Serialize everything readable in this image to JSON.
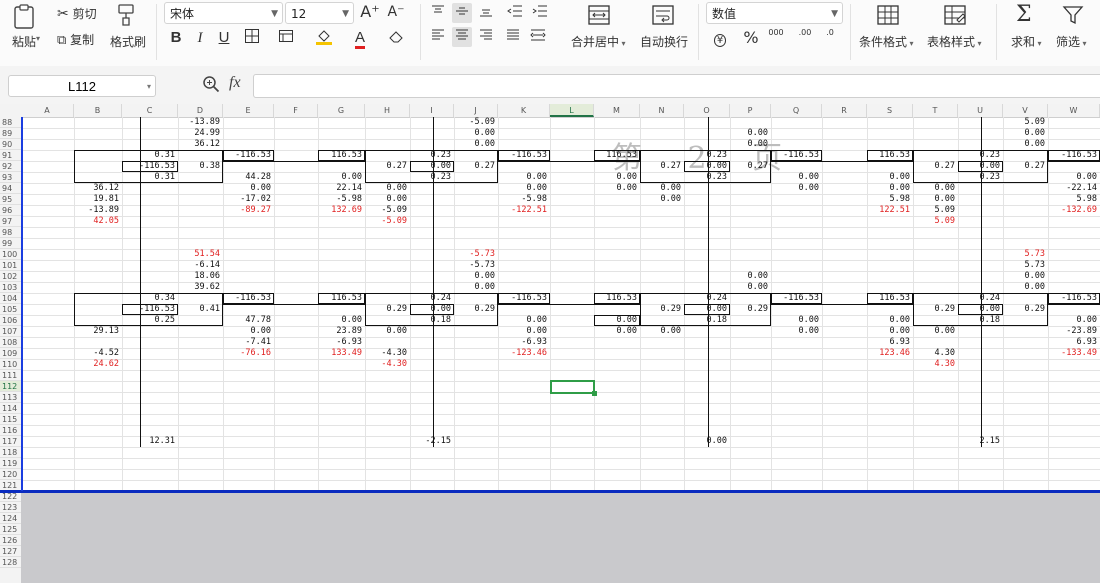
{
  "ribbon": {
    "paste_label": "粘贴",
    "cut_label": "剪切",
    "copy_label": "复制",
    "format_painter_label": "格式刷",
    "font_name": "宋体",
    "font_size": "12",
    "merge_center_label": "合并居中",
    "wrap_text_label": "自动换行",
    "number_format": "数值",
    "conditional_format_label": "条件格式",
    "table_style_label": "表格样式",
    "sum_label": "求和",
    "filter_label": "筛选",
    "grow_font": "A⁺",
    "shrink_font": "A⁻",
    "bold": "B",
    "italic": "I",
    "underline": "U",
    "percent": "%",
    "thousands": "000",
    "inc_decimal": ".00",
    "dec_decimal": ".0",
    "currency": "¥"
  },
  "formula_bar": {
    "name_box": "L112",
    "fx": "fx",
    "formula": ""
  },
  "watermark": "第 2 页",
  "columns": [
    "A",
    "B",
    "C",
    "D",
    "E",
    "F",
    "G",
    "H",
    "I",
    "J",
    "K",
    "L",
    "M",
    "N",
    "O",
    "P",
    "Q",
    "R",
    "S",
    "T",
    "U",
    "V",
    "W"
  ],
  "active_column": "L",
  "rows": [
    "88",
    "89",
    "90",
    "91",
    "92",
    "93",
    "94",
    "95",
    "96",
    "97",
    "98",
    "99",
    "100",
    "101",
    "102",
    "103",
    "104",
    "105",
    "106",
    "107",
    "108",
    "109",
    "110",
    "111",
    "112",
    "113",
    "114",
    "115",
    "116",
    "117",
    "118",
    "119",
    "120",
    "121",
    "122",
    "123",
    "124",
    "125",
    "126",
    "127",
    "128"
  ],
  "active_row": "112",
  "cells": [
    {
      "r": "88",
      "c": "D",
      "v": "-13.89"
    },
    {
      "r": "89",
      "c": "D",
      "v": "24.99"
    },
    {
      "r": "90",
      "c": "D",
      "v": "36.12"
    },
    {
      "r": "88",
      "c": "J",
      "v": "-5.09"
    },
    {
      "r": "89",
      "c": "J",
      "v": "0.00"
    },
    {
      "r": "90",
      "c": "J",
      "v": "0.00"
    },
    {
      "r": "89",
      "c": "P",
      "v": "0.00"
    },
    {
      "r": "90",
      "c": "P",
      "v": "0.00"
    },
    {
      "r": "88",
      "c": "V",
      "v": "5.09"
    },
    {
      "r": "89",
      "c": "V",
      "v": "0.00"
    },
    {
      "r": "90",
      "c": "V",
      "v": "0.00"
    },
    {
      "r": "91",
      "c": "C",
      "v": "0.31"
    },
    {
      "r": "91",
      "c": "E",
      "v": "-116.53"
    },
    {
      "r": "91",
      "c": "G",
      "v": "116.53"
    },
    {
      "r": "91",
      "c": "I",
      "v": "0.23"
    },
    {
      "r": "91",
      "c": "K",
      "v": "-116.53"
    },
    {
      "r": "91",
      "c": "M",
      "v": "116.53"
    },
    {
      "r": "91",
      "c": "O",
      "v": "0.23"
    },
    {
      "r": "91",
      "c": "Q",
      "v": "-116.53"
    },
    {
      "r": "91",
      "c": "S",
      "v": "116.53"
    },
    {
      "r": "91",
      "c": "U",
      "v": "0.23"
    },
    {
      "r": "91",
      "c": "W",
      "v": "-116.53"
    },
    {
      "r": "92",
      "c": "C",
      "v": "-116.53"
    },
    {
      "r": "92",
      "c": "D",
      "v": "0.38"
    },
    {
      "r": "92",
      "c": "H",
      "v": "0.27"
    },
    {
      "r": "92",
      "c": "I",
      "v": "0.00"
    },
    {
      "r": "92",
      "c": "J",
      "v": "0.27"
    },
    {
      "r": "92",
      "c": "N",
      "v": "0.27"
    },
    {
      "r": "92",
      "c": "O",
      "v": "0.00"
    },
    {
      "r": "92",
      "c": "P",
      "v": "0.27"
    },
    {
      "r": "92",
      "c": "T",
      "v": "0.27"
    },
    {
      "r": "92",
      "c": "U",
      "v": "0.00"
    },
    {
      "r": "92",
      "c": "V",
      "v": "0.27"
    },
    {
      "r": "93",
      "c": "C",
      "v": "0.31"
    },
    {
      "r": "93",
      "c": "E",
      "v": "44.28"
    },
    {
      "r": "93",
      "c": "G",
      "v": "0.00"
    },
    {
      "r": "93",
      "c": "I",
      "v": "0.23"
    },
    {
      "r": "93",
      "c": "K",
      "v": "0.00"
    },
    {
      "r": "93",
      "c": "M",
      "v": "0.00"
    },
    {
      "r": "93",
      "c": "O",
      "v": "0.23"
    },
    {
      "r": "93",
      "c": "Q",
      "v": "0.00"
    },
    {
      "r": "93",
      "c": "S",
      "v": "0.00"
    },
    {
      "r": "93",
      "c": "U",
      "v": "0.23"
    },
    {
      "r": "93",
      "c": "W",
      "v": "0.00"
    },
    {
      "r": "94",
      "c": "B",
      "v": "36.12"
    },
    {
      "r": "94",
      "c": "E",
      "v": "0.00"
    },
    {
      "r": "94",
      "c": "G",
      "v": "22.14"
    },
    {
      "r": "94",
      "c": "H",
      "v": "0.00"
    },
    {
      "r": "94",
      "c": "K",
      "v": "0.00"
    },
    {
      "r": "94",
      "c": "M",
      "v": "0.00"
    },
    {
      "r": "94",
      "c": "N",
      "v": "0.00"
    },
    {
      "r": "94",
      "c": "Q",
      "v": "0.00"
    },
    {
      "r": "94",
      "c": "S",
      "v": "0.00"
    },
    {
      "r": "94",
      "c": "T",
      "v": "0.00"
    },
    {
      "r": "94",
      "c": "W",
      "v": "-22.14"
    },
    {
      "r": "95",
      "c": "B",
      "v": "19.81"
    },
    {
      "r": "95",
      "c": "E",
      "v": "-17.02"
    },
    {
      "r": "95",
      "c": "G",
      "v": "-5.98"
    },
    {
      "r": "95",
      "c": "H",
      "v": "0.00"
    },
    {
      "r": "95",
      "c": "K",
      "v": "-5.98"
    },
    {
      "r": "95",
      "c": "N",
      "v": "0.00"
    },
    {
      "r": "95",
      "c": "S",
      "v": "5.98"
    },
    {
      "r": "95",
      "c": "T",
      "v": "0.00"
    },
    {
      "r": "95",
      "c": "W",
      "v": "5.98"
    },
    {
      "r": "96",
      "c": "B",
      "v": "-13.89"
    },
    {
      "r": "96",
      "c": "E",
      "v": "-89.27",
      "red": true
    },
    {
      "r": "96",
      "c": "G",
      "v": "132.69",
      "red": true
    },
    {
      "r": "96",
      "c": "H",
      "v": "-5.09"
    },
    {
      "r": "96",
      "c": "K",
      "v": "-122.51",
      "red": true
    },
    {
      "r": "96",
      "c": "S",
      "v": "122.51",
      "red": true
    },
    {
      "r": "96",
      "c": "T",
      "v": "5.09"
    },
    {
      "r": "96",
      "c": "W",
      "v": "-132.69",
      "red": true
    },
    {
      "r": "97",
      "c": "B",
      "v": "42.05",
      "red": true
    },
    {
      "r": "97",
      "c": "H",
      "v": "-5.09",
      "red": true
    },
    {
      "r": "97",
      "c": "T",
      "v": "5.09",
      "red": true
    },
    {
      "r": "100",
      "c": "D",
      "v": "51.54",
      "red": true
    },
    {
      "r": "101",
      "c": "D",
      "v": "-6.14"
    },
    {
      "r": "102",
      "c": "D",
      "v": "18.06"
    },
    {
      "r": "103",
      "c": "D",
      "v": "39.62"
    },
    {
      "r": "100",
      "c": "J",
      "v": "-5.73",
      "red": true
    },
    {
      "r": "101",
      "c": "J",
      "v": "-5.73"
    },
    {
      "r": "102",
      "c": "J",
      "v": "0.00"
    },
    {
      "r": "103",
      "c": "J",
      "v": "0.00"
    },
    {
      "r": "102",
      "c": "P",
      "v": "0.00"
    },
    {
      "r": "103",
      "c": "P",
      "v": "0.00"
    },
    {
      "r": "100",
      "c": "V",
      "v": "5.73",
      "red": true
    },
    {
      "r": "101",
      "c": "V",
      "v": "5.73"
    },
    {
      "r": "102",
      "c": "V",
      "v": "0.00"
    },
    {
      "r": "103",
      "c": "V",
      "v": "0.00"
    },
    {
      "r": "104",
      "c": "C",
      "v": "0.34"
    },
    {
      "r": "104",
      "c": "E",
      "v": "-116.53"
    },
    {
      "r": "104",
      "c": "G",
      "v": "116.53"
    },
    {
      "r": "104",
      "c": "I",
      "v": "0.24"
    },
    {
      "r": "104",
      "c": "K",
      "v": "-116.53"
    },
    {
      "r": "104",
      "c": "M",
      "v": "116.53"
    },
    {
      "r": "104",
      "c": "O",
      "v": "0.24"
    },
    {
      "r": "104",
      "c": "Q",
      "v": "-116.53"
    },
    {
      "r": "104",
      "c": "S",
      "v": "116.53"
    },
    {
      "r": "104",
      "c": "U",
      "v": "0.24"
    },
    {
      "r": "104",
      "c": "W",
      "v": "-116.53"
    },
    {
      "r": "105",
      "c": "C",
      "v": "-116.53"
    },
    {
      "r": "105",
      "c": "D",
      "v": "0.41"
    },
    {
      "r": "105",
      "c": "H",
      "v": "0.29"
    },
    {
      "r": "105",
      "c": "I",
      "v": "0.00"
    },
    {
      "r": "105",
      "c": "J",
      "v": "0.29"
    },
    {
      "r": "105",
      "c": "N",
      "v": "0.29"
    },
    {
      "r": "105",
      "c": "O",
      "v": "0.00"
    },
    {
      "r": "105",
      "c": "P",
      "v": "0.29"
    },
    {
      "r": "105",
      "c": "T",
      "v": "0.29"
    },
    {
      "r": "105",
      "c": "U",
      "v": "0.00"
    },
    {
      "r": "105",
      "c": "V",
      "v": "0.29"
    },
    {
      "r": "106",
      "c": "C",
      "v": "0.25"
    },
    {
      "r": "106",
      "c": "E",
      "v": "47.78"
    },
    {
      "r": "106",
      "c": "G",
      "v": "0.00"
    },
    {
      "r": "106",
      "c": "I",
      "v": "0.18"
    },
    {
      "r": "106",
      "c": "K",
      "v": "0.00"
    },
    {
      "r": "106",
      "c": "M",
      "v": "0.00"
    },
    {
      "r": "106",
      "c": "O",
      "v": "0.18"
    },
    {
      "r": "106",
      "c": "Q",
      "v": "0.00"
    },
    {
      "r": "106",
      "c": "S",
      "v": "0.00"
    },
    {
      "r": "106",
      "c": "U",
      "v": "0.18"
    },
    {
      "r": "106",
      "c": "W",
      "v": "0.00"
    },
    {
      "r": "107",
      "c": "B",
      "v": "29.13"
    },
    {
      "r": "107",
      "c": "E",
      "v": "0.00"
    },
    {
      "r": "107",
      "c": "G",
      "v": "23.89"
    },
    {
      "r": "107",
      "c": "H",
      "v": "0.00"
    },
    {
      "r": "107",
      "c": "K",
      "v": "0.00"
    },
    {
      "r": "107",
      "c": "M",
      "v": "0.00"
    },
    {
      "r": "107",
      "c": "N",
      "v": "0.00"
    },
    {
      "r": "107",
      "c": "Q",
      "v": "0.00"
    },
    {
      "r": "107",
      "c": "S",
      "v": "0.00"
    },
    {
      "r": "107",
      "c": "T",
      "v": "0.00"
    },
    {
      "r": "107",
      "c": "W",
      "v": "-23.89"
    },
    {
      "r": "108",
      "c": "E",
      "v": "-7.41"
    },
    {
      "r": "108",
      "c": "G",
      "v": "-6.93"
    },
    {
      "r": "108",
      "c": "K",
      "v": "-6.93"
    },
    {
      "r": "108",
      "c": "S",
      "v": "6.93"
    },
    {
      "r": "108",
      "c": "W",
      "v": "6.93"
    },
    {
      "r": "109",
      "c": "B",
      "v": "-4.52"
    },
    {
      "r": "109",
      "c": "E",
      "v": "-76.16",
      "red": true
    },
    {
      "r": "109",
      "c": "G",
      "v": "133.49",
      "red": true
    },
    {
      "r": "109",
      "c": "H",
      "v": "-4.30"
    },
    {
      "r": "109",
      "c": "K",
      "v": "-123.46",
      "red": true
    },
    {
      "r": "109",
      "c": "S",
      "v": "123.46",
      "red": true
    },
    {
      "r": "109",
      "c": "T",
      "v": "4.30"
    },
    {
      "r": "109",
      "c": "W",
      "v": "-133.49",
      "red": true
    },
    {
      "r": "110",
      "c": "B",
      "v": "24.62",
      "red": true
    },
    {
      "r": "110",
      "c": "H",
      "v": "-4.30",
      "red": true
    },
    {
      "r": "110",
      "c": "T",
      "v": "4.30",
      "red": true
    },
    {
      "r": "117",
      "c": "C",
      "v": "12.31"
    },
    {
      "r": "117",
      "c": "I",
      "v": "-2.15"
    },
    {
      "r": "117",
      "c": "O",
      "v": "0.00"
    },
    {
      "r": "117",
      "c": "U",
      "v": "2.15"
    }
  ]
}
